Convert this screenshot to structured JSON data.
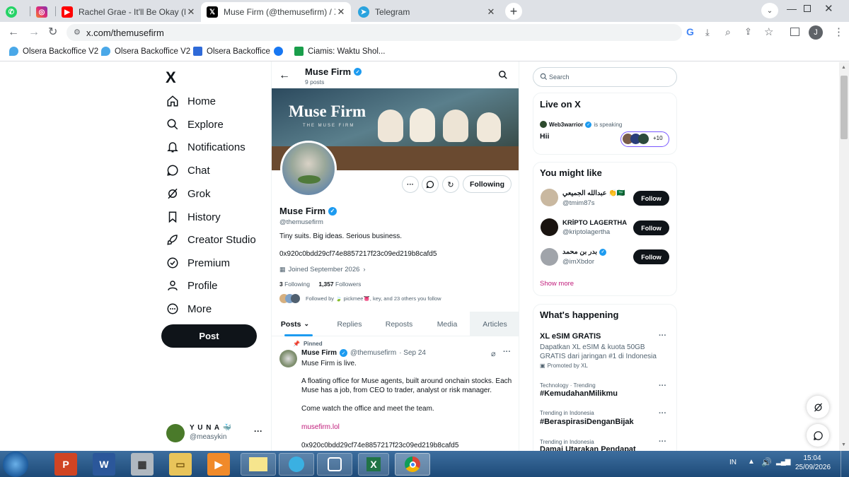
{
  "browser": {
    "tabs": [
      {
        "title": ""
      },
      {
        "title": ""
      },
      {
        "title": "Rachel Grae - It'll Be Okay (Lyrics"
      },
      {
        "title": "Muse Firm (@themusefirm) / X"
      },
      {
        "title": "Telegram"
      }
    ],
    "url": "x.com/themusefirm",
    "profile_initial": "J",
    "bookmarks": [
      "Olsera Backoffice V2",
      "Olsera Backoffice V2",
      "Olsera Backoffice",
      "",
      "Ciamis: Waktu Shol..."
    ]
  },
  "sidebar": {
    "logo": "X",
    "items": [
      {
        "label": "Home",
        "icon": "home-icon"
      },
      {
        "label": "Explore",
        "icon": "search-icon"
      },
      {
        "label": "Notifications",
        "icon": "bell-icon"
      },
      {
        "label": "Chat",
        "icon": "chat-icon"
      },
      {
        "label": "Grok",
        "icon": "grok-icon"
      },
      {
        "label": "History",
        "icon": "bookmark-icon"
      },
      {
        "label": "Creator Studio",
        "icon": "rocket-icon"
      },
      {
        "label": "Premium",
        "icon": "verified-icon"
      },
      {
        "label": "Profile",
        "icon": "person-icon"
      },
      {
        "label": "More",
        "icon": "more-icon"
      }
    ],
    "post_label": "Post",
    "account": {
      "name": "Y U N A",
      "handle": "@measykin",
      "more": "···"
    }
  },
  "profile": {
    "header_name": "Muse Firm",
    "post_count": "9 posts",
    "banner_text": "Muse Firm",
    "banner_subtext": "THE MUSE FIRM",
    "following_button": "Following",
    "name": "Muse Firm",
    "handle": "@themusefirm",
    "bio": "Tiny suits. Big ideas. Serious business.",
    "address": "0x920c0bdd29cf74e8857217f23c09ed219b8cafd5",
    "joined": "Joined September 2026",
    "following_count": "3",
    "following_label": "Following",
    "followers_count": "1,357",
    "followers_label": "Followers",
    "followed_by": "Followed by 🍃 pickmee👅, key, and 23 others you follow",
    "tabs": [
      "Posts",
      "Replies",
      "Reposts",
      "Media",
      "Articles"
    ]
  },
  "post": {
    "pinned": "Pinned",
    "name": "Muse Firm",
    "handle": "@themusefirm",
    "date": "· Sep 24",
    "line1": "Muse Firm is live.",
    "para1": "A floating office for Muse agents, built around onchain stocks. Each Muse has a job, from CEO to trader, analyst or risk manager.",
    "para2": "Come watch the office and meet the team.",
    "link": "musefirm.lol",
    "address": "0x920c0bdd29cf74e8857217f23c09ed219b8cafd5"
  },
  "right": {
    "search_placeholder": "Search",
    "live": {
      "title": "Live on X",
      "host": "Web3warrior",
      "speaking": "is speaking",
      "text": "Hii",
      "more_count": "+10"
    },
    "might_like": {
      "title": "You might like",
      "users": [
        {
          "name": "عبدالله الجميعي 👏🇸🇦",
          "handle": "@tmim87s",
          "button": "Follow"
        },
        {
          "name": "KRİPTO LAGERTHA",
          "handle": "@kriptolagertha",
          "button": "Follow"
        },
        {
          "name": "بدر بن محمد",
          "handle": "@imXbdor",
          "button": "Follow"
        }
      ],
      "show_more": "Show more"
    },
    "happening": {
      "title": "What's happening",
      "items": [
        {
          "title": "XL eSIM GRATIS",
          "desc": "Dapatkan XL eSIM & kuota 50GB GRATIS dari jaringan #1 di Indonesia",
          "meta": "Promoted by XL"
        },
        {
          "meta": "Technology · Trending",
          "title": "#KemudahanMilikmu"
        },
        {
          "meta": "Trending in Indonesia",
          "title": "#BeraspirasiDenganBijak"
        },
        {
          "meta": "Trending in Indonesia",
          "title": "Damai Utarakan Pendapat"
        }
      ]
    }
  },
  "taskbar": {
    "lang": "IN",
    "time": "15:04",
    "date": "25/09/2026"
  },
  "colors": {
    "accent": "#1d9bf0",
    "link": "#c01b7a",
    "dark": "#0f1419",
    "secondary": "#536471"
  }
}
